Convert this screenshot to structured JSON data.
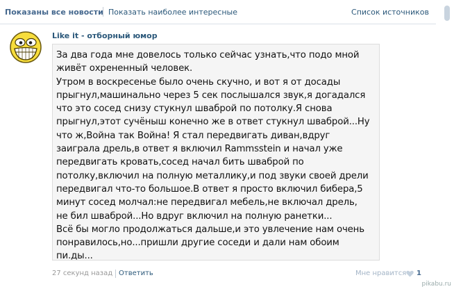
{
  "header": {
    "tab_active": "Показаны все новости",
    "tab_interesting": "Показать наиболее интересные",
    "sources_link": "Список источников"
  },
  "post": {
    "source_name": "Like it - отборный юмор",
    "avatar_icon": "troll-smile-face-icon",
    "text_lines": [
      "За два года мне довелось только сейчас узнать,что подо мной",
      "живёт охрененный человек.",
      " Утром в воскресенье было очень скучно, и вот я от досады",
      "прыгнул,машинально через 5 сек послышался звук,я догадался",
      "что это сосед снизу стукнул шваброй по потолку.Я снова",
      "прыгнул,этот сучёныш конечно же в ответ стукнул шваброй...Ну",
      "что ж,Война так Война! Я стал передвигать диван,вдруг",
      "заиграла дрель,в ответ я включил Rammsstein и начал уже",
      "передвигать кровать,сосед начал бить шваброй по",
      "потолку,включил на полную металлику,и под звуки своей дрели",
      "передвигал что-то большое.В ответ я просто включил бибера,5",
      "минут сосед молчал:не передвигал мебель,не включал дрель,",
      "не бил шваброй...Но вдруг включил на полную ранетки...",
      " Всё бы могло продолжаться дальше,и это увлечение нам очень",
      "понравилось,но...пришли другие соседи и дали нам обоим",
      "пи.ды..."
    ],
    "timestamp": "27 секунд назад",
    "reply_label": "Ответить",
    "like_label": "Мне нравится",
    "like_count": "1"
  },
  "watermark": "pikabu.ru",
  "colors": {
    "link": "#2b587a",
    "header_active": "#45688e",
    "muted": "#999999"
  }
}
